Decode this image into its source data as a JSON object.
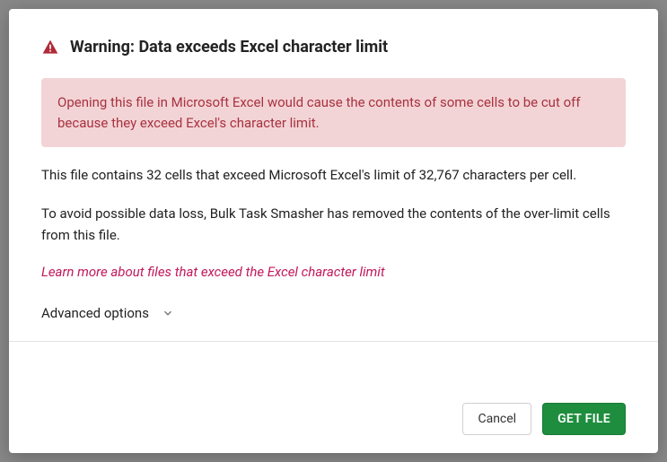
{
  "modal": {
    "title": "Warning: Data exceeds Excel character limit",
    "alert": "Opening this file in Microsoft Excel would cause the contents of some cells to be cut off because they exceed Excel's character limit.",
    "body1": "This file contains 32 cells that exceed Microsoft Excel's limit of 32,767 characters per cell.",
    "body2": "To avoid possible data loss, Bulk Task Smasher has removed the contents of the over-limit cells from this file.",
    "learn_more": "Learn more about files that exceed the Excel character limit",
    "advanced_label": "Advanced options",
    "cancel_label": "Cancel",
    "primary_label": "GET FILE"
  }
}
